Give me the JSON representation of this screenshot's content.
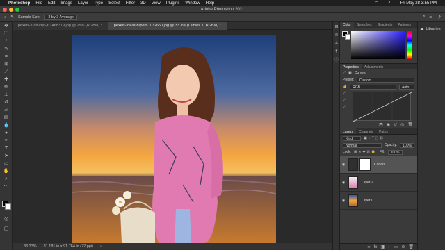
{
  "menubar": {
    "apple": "",
    "app_name": "Photoshop",
    "items": [
      "File",
      "Edit",
      "Image",
      "Layer",
      "Type",
      "Select",
      "Filter",
      "3D",
      "View",
      "Plugins",
      "Window",
      "Help"
    ],
    "datetime": "Fri May 28  3:55 PM"
  },
  "window": {
    "title": "Adobe Photoshop 2021"
  },
  "options": {
    "tool": "✎",
    "sample_size_label": "Sample Size:",
    "sample_size_value": "3 by 3 Average",
    "share_label": "⤴"
  },
  "tabs": [
    {
      "label": "pexels-tuấn-kiệt-jr-1468379.jpg @ 25% (RGB/8) *"
    },
    {
      "label": "pexels-travis-rupert-1032650.jpg @ 33.3% (Curves 1, RGB/8) *"
    }
  ],
  "status": {
    "zoom": "33.33%",
    "doc_size": "81.181 in x 91.764 in (72 ppi)"
  },
  "color_panel": {
    "tabs": [
      "Color",
      "Swatches",
      "Gradients",
      "Patterns"
    ]
  },
  "properties": {
    "tabs": [
      "Properties",
      "Adjustments"
    ],
    "adjustment": "Curves",
    "preset_label": "Preset:",
    "preset_value": "Custom",
    "channel_value": "RGB",
    "auto_label": "Auto"
  },
  "layers_panel": {
    "tabs": [
      "Layers",
      "Channels",
      "Paths"
    ],
    "filter_label": "Kind",
    "blend_mode": "Normal",
    "opacity_label": "Opacity:",
    "opacity_value": "100%",
    "lock_label": "Lock:",
    "fill_label": "Fill:",
    "fill_value": "100%",
    "layers": [
      {
        "name": "Curves 1",
        "selected": true
      },
      {
        "name": "Layer 2",
        "selected": false
      },
      {
        "name": "Layer 0",
        "selected": false
      }
    ]
  },
  "libraries": {
    "label": "Libraries"
  }
}
